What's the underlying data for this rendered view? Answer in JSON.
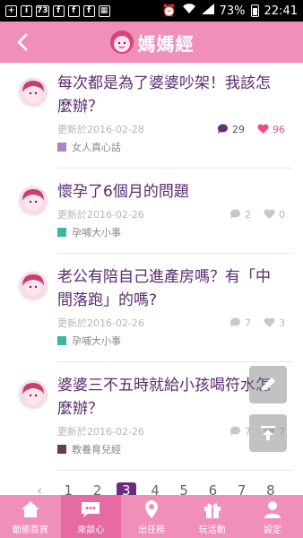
{
  "status": {
    "battery": "73%",
    "time": "22:41"
  },
  "header": {
    "logo_text": "媽媽經"
  },
  "posts": [
    {
      "title": "每次都是為了婆婆吵架！我該怎麼辦？",
      "date": "更新於2016-02-28",
      "comments": "29",
      "likes": "96",
      "category": "女人真心話",
      "category_color": "#a984c9"
    },
    {
      "title": "懷孕了6個月的問題",
      "date": "更新於2016-02-26",
      "comments": "2",
      "likes": "0",
      "category": "孕哺大小事",
      "category_color": "#3fb3a4"
    },
    {
      "title": "老公有陪自己進產房嗎？有「中間落跑」的嗎?",
      "date": "更新於2016-02-26",
      "comments": "7",
      "likes": "3",
      "category": "孕哺大小事",
      "category_color": "#3fb3a4"
    },
    {
      "title": "婆婆三不五時就給小孩喝符水怎麼辦？",
      "date": "更新於2016-02-26",
      "comments": "7",
      "likes": "7",
      "category": "教養育兒經",
      "category_color": "#6e3a52"
    }
  ],
  "pager": {
    "pages": [
      "1",
      "2",
      "3",
      "4",
      "5",
      "6",
      "7",
      "8"
    ],
    "active": "3"
  },
  "nav": [
    {
      "label": "動態首頁",
      "icon": "home-icon"
    },
    {
      "label": "來談心",
      "icon": "chat-icon"
    },
    {
      "label": "出任務",
      "icon": "task-icon"
    },
    {
      "label": "玩活動",
      "icon": "gift-icon"
    },
    {
      "label": "設定",
      "icon": "user-icon"
    }
  ],
  "colors": {
    "accent": "#f08fb9",
    "title": "#5a2a6e",
    "like": "#ee4c84",
    "comment": "#6b2b7d"
  }
}
